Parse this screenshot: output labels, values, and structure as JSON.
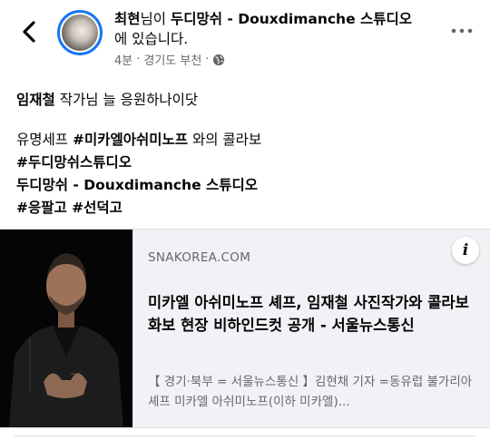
{
  "header": {
    "author": "최현",
    "connector": "님이 ",
    "place": "두디망쉬 - Douxdimanche 스튜디오",
    "suffix": "에 있습니다.",
    "time": "4분",
    "dot": "·",
    "location": "경기도 부천",
    "dot2": "·"
  },
  "post": {
    "line1_bold": "임재철",
    "line1_rest": " 작가님 늘 응원하나이닷",
    "line2_plain": "유명세프 ",
    "line2_bold": "#미카엘아쉬미노프",
    "line2_rest": " 와의 콜라보",
    "line3": "#두디망쉬스튜디오",
    "line4": "두디망쉬 - Douxdimanche 스튜디오",
    "line5": "#응팔고 #선덕고"
  },
  "link_card": {
    "domain": "SNAKOREA.COM",
    "title": "미카엘 아쉬미노프 셰프, 임재철 사진작가와 콜라보 화보 현장 비하인드컷 공개 - 서울뉴스통신",
    "description": "【 경기·북부 = 서울뉴스통신 】김현채 기자 =동유럽 불가리아 셰프 미카엘 아쉬미노프(이하 미카엘)...",
    "info_symbol": "i"
  }
}
